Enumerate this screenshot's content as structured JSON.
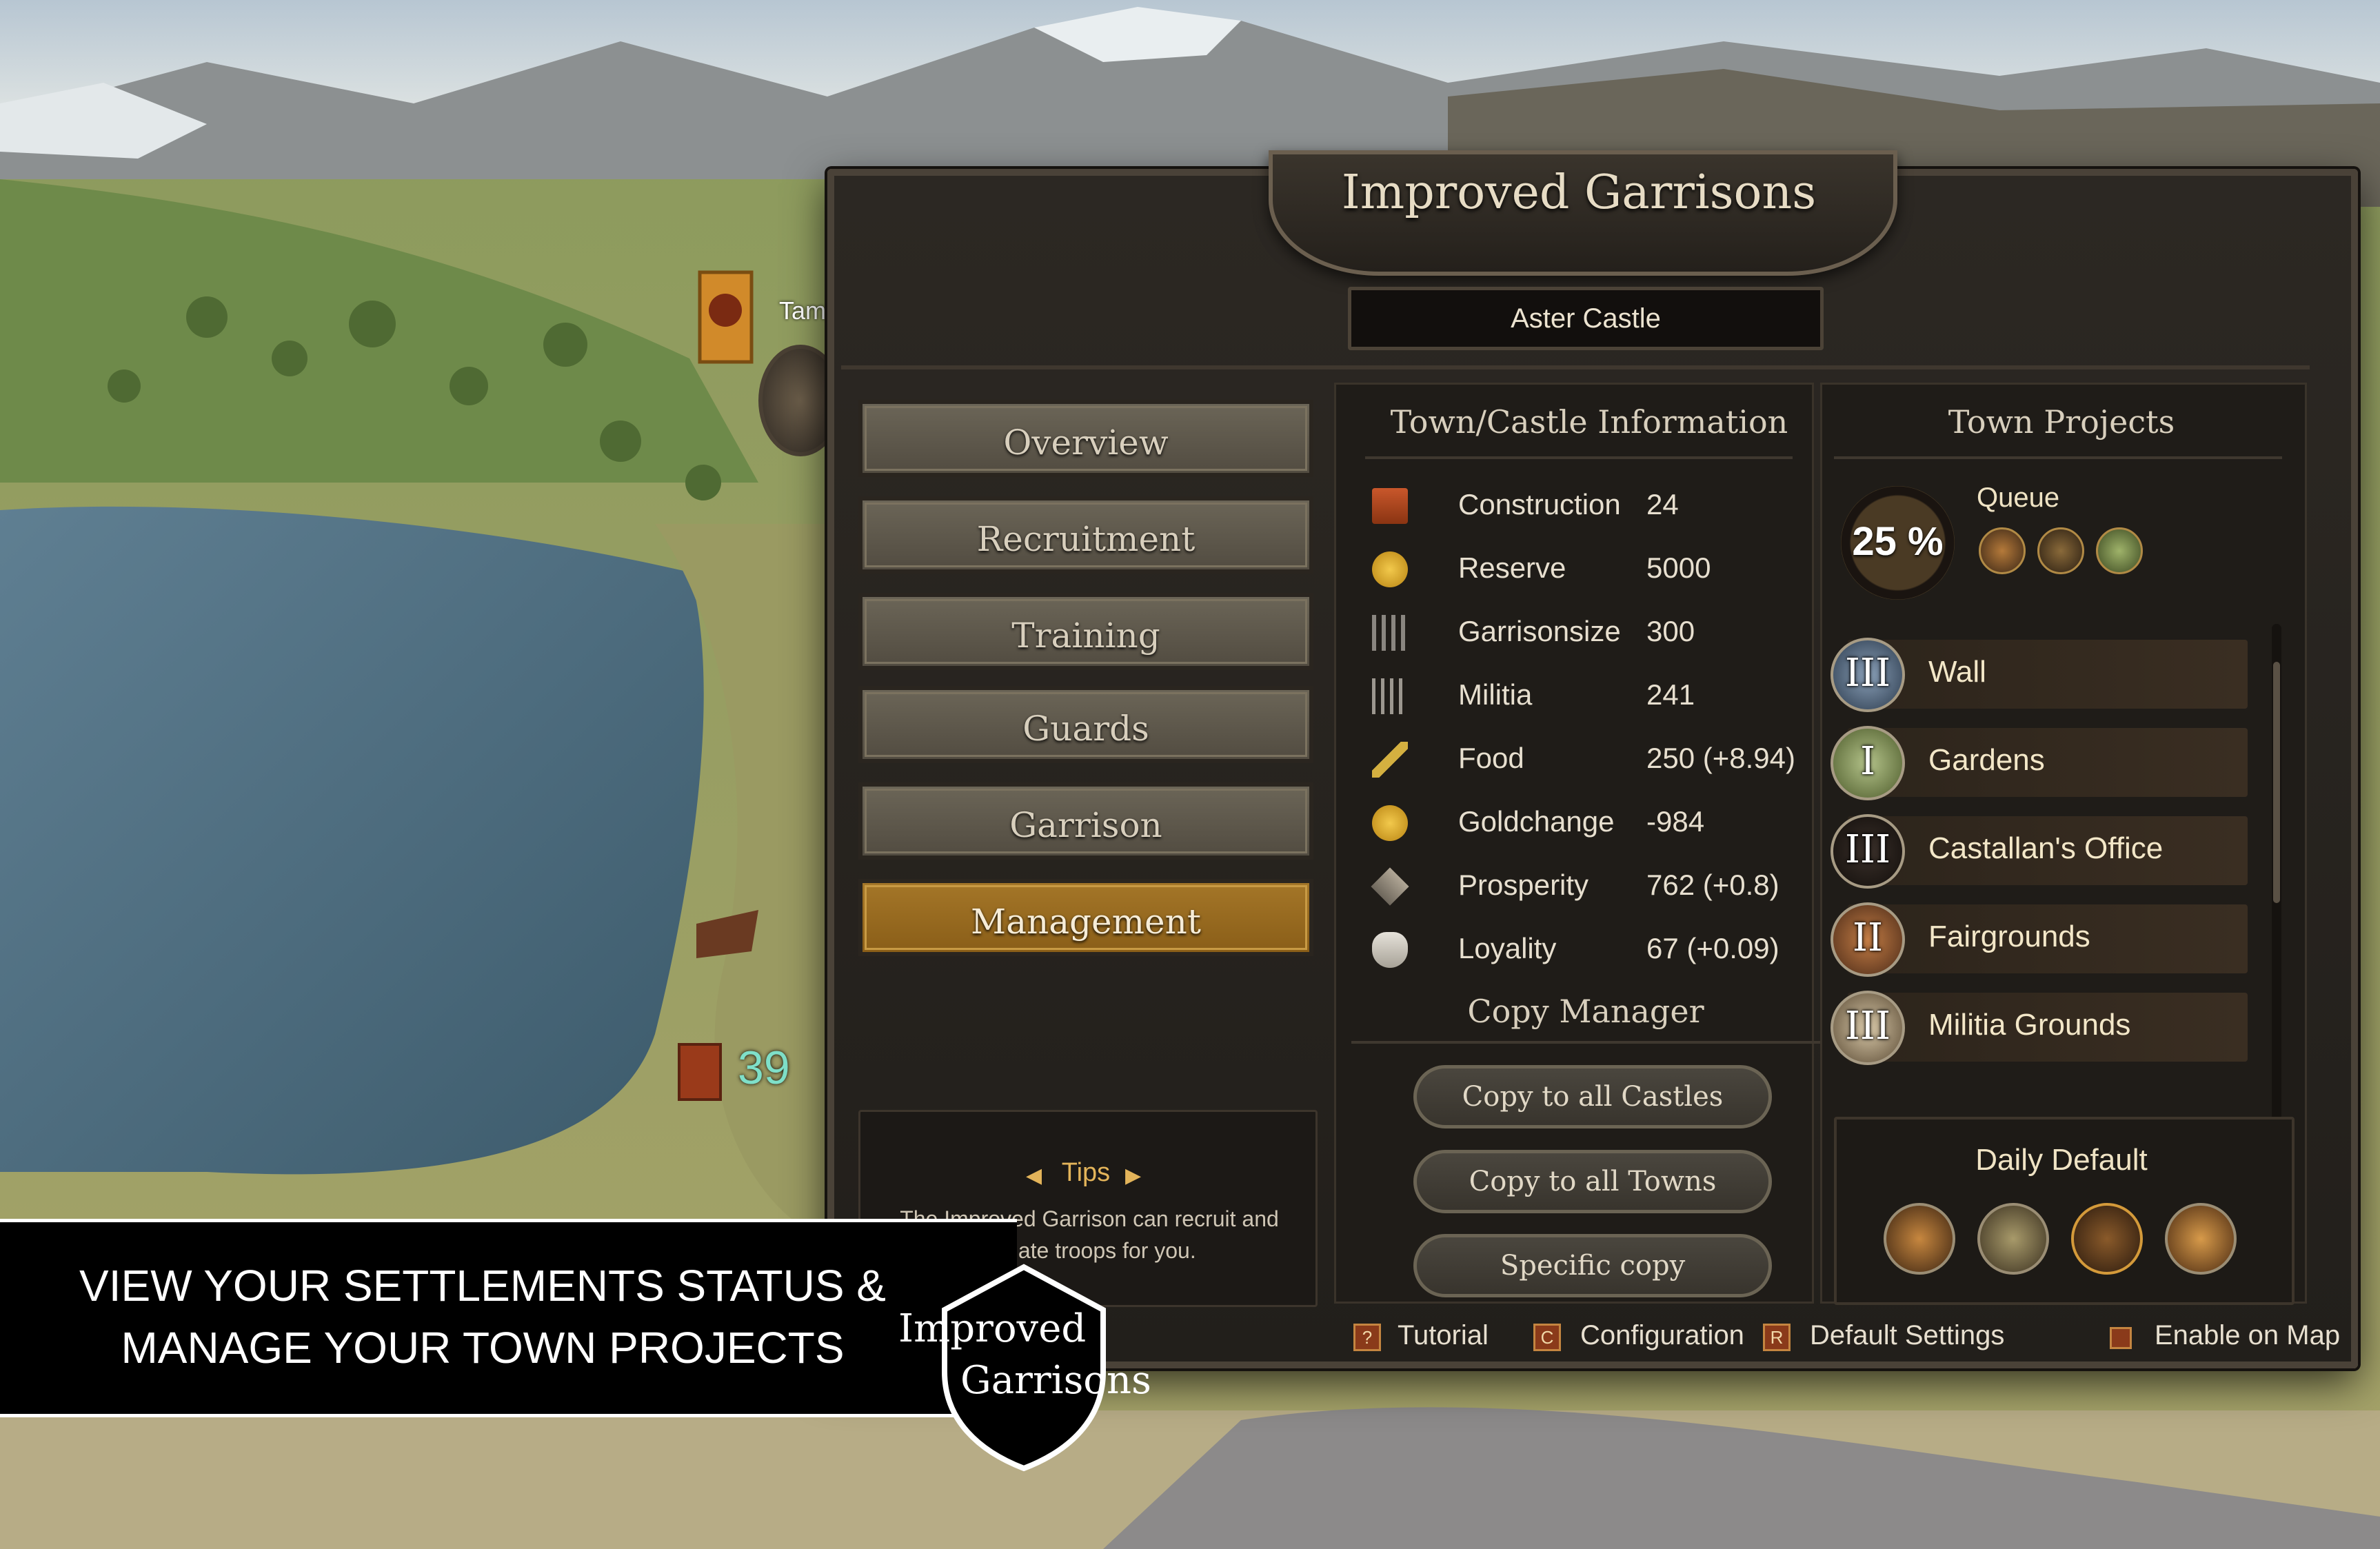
{
  "window": {
    "title": "Improved Garrisons",
    "settlement_name": "Aster Castle"
  },
  "map": {
    "party_count": "39",
    "map_label_partial": "Tam"
  },
  "nav": {
    "items": [
      {
        "label": "Overview",
        "active": false
      },
      {
        "label": "Recruitment",
        "active": false
      },
      {
        "label": "Training",
        "active": false
      },
      {
        "label": "Guards",
        "active": false
      },
      {
        "label": "Garrison",
        "active": false
      },
      {
        "label": "Management",
        "active": true
      }
    ]
  },
  "tips": {
    "title": "Tips",
    "text_line1": "The Improved Garrison can recruit and",
    "text_line2": "mplate troops for you."
  },
  "info": {
    "title": "Town/Castle Information",
    "stats": [
      {
        "label": "Construction",
        "value": "24",
        "icon": "bricks-icon"
      },
      {
        "label": "Reserve",
        "value": "5000",
        "icon": "gold-coin-icon"
      },
      {
        "label": "Garrisonsize",
        "value": "300",
        "icon": "spears-icon"
      },
      {
        "label": "Militia",
        "value": "241",
        "icon": "pitchfork-icon"
      },
      {
        "label": "Food",
        "value": "250 (+8.94)",
        "icon": "wheat-icon"
      },
      {
        "label": "Goldchange",
        "value": "-984",
        "icon": "gold-coin-icon"
      },
      {
        "label": "Prosperity",
        "value": "762 (+0.8)",
        "icon": "diamond-icon"
      },
      {
        "label": "Loyality",
        "value": "67 (+0.09)",
        "icon": "mask-icon"
      }
    ]
  },
  "copy_manager": {
    "title": "Copy Manager",
    "buttons": [
      "Copy to all Castles",
      "Copy to all Towns",
      "Specific copy"
    ]
  },
  "projects": {
    "title": "Town Projects",
    "queue_label": "Queue",
    "queue_progress": "25 %",
    "queue_progress_fraction": 0.25,
    "list": [
      {
        "tier": "III",
        "name": "Wall"
      },
      {
        "tier": "I",
        "name": "Gardens"
      },
      {
        "tier": "III",
        "name": "Castallan's Office"
      },
      {
        "tier": "II",
        "name": "Fairgrounds"
      },
      {
        "tier": "III",
        "name": "Militia Grounds"
      }
    ],
    "daily_default_label": "Daily Default"
  },
  "footer": {
    "items": [
      {
        "key": "?",
        "label": "Tutorial"
      },
      {
        "key": "C",
        "label": "Configuration"
      },
      {
        "key": "R",
        "label": "Default Settings"
      },
      {
        "key": "",
        "label": "Enable on Map"
      }
    ]
  },
  "banner": {
    "line1": "VIEW YOUR SETTLEMENTS STATUS &",
    "line2": "MANAGE YOUR TOWN PROJECTS",
    "logo_line1": "Improved",
    "logo_line2": "Garrisons"
  },
  "colors": {
    "active_tab": "#a47628",
    "gold_accent": "#c89a44",
    "panel_bg": "#2c2823"
  }
}
